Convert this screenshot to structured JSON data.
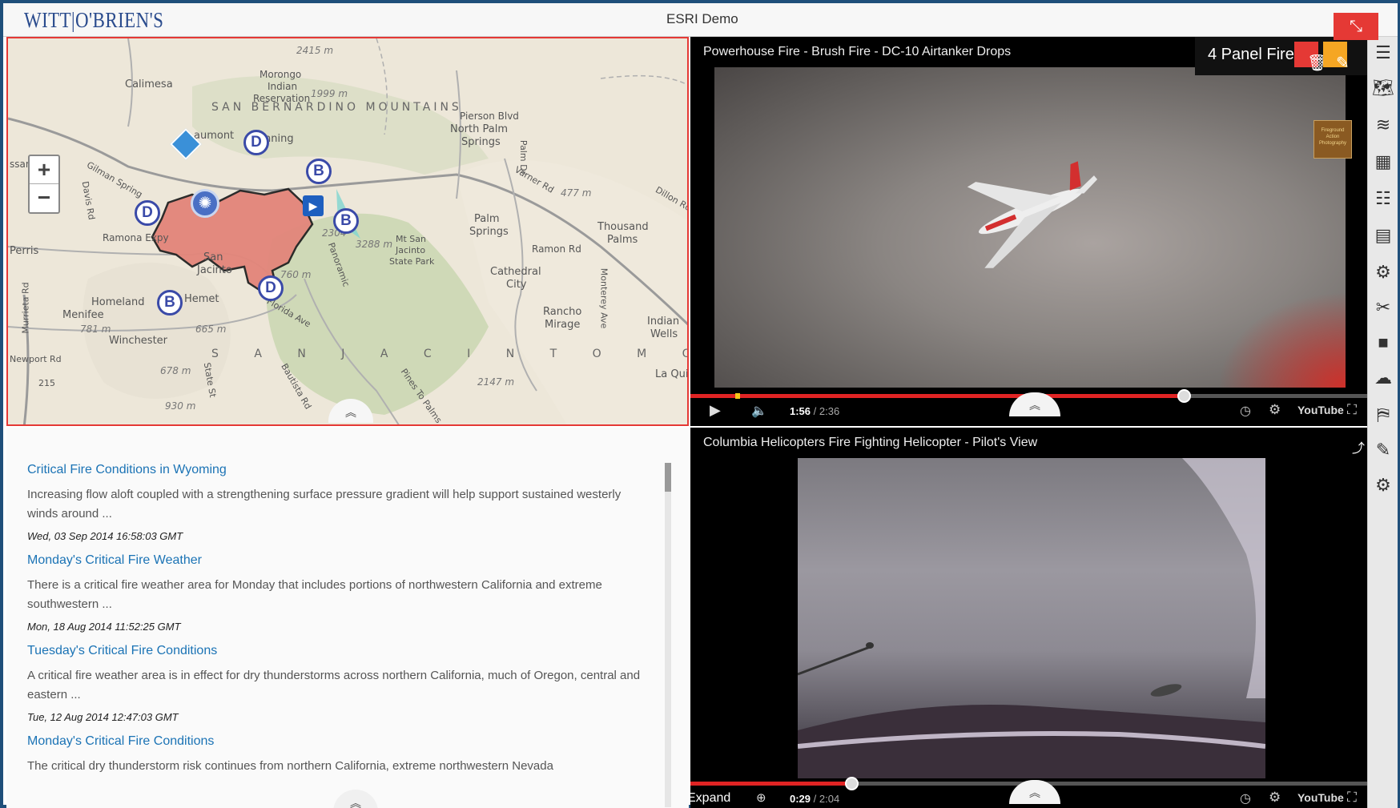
{
  "header": {
    "logo": "WITT|O'BRIEN'S",
    "title": "ESRI Demo",
    "collapse_icon": "compress-arrows-icon"
  },
  "map": {
    "zoom_in": "+",
    "zoom_out": "−",
    "labels": {
      "calimesa": "Calimesa",
      "morongo": "Morongo",
      "indian": "Indian",
      "reservation": "Reservation",
      "elev_2415": "2415 m",
      "elev_1999": "1999 m",
      "sbm": "SAN BERNARDINO MOUNTAINS",
      "pierson": "Pierson Blvd",
      "north_palm": "North Palm",
      "springs": "Springs",
      "beaumont": "aumont",
      "banning": "nning",
      "ramona": "Ramona Expy",
      "perris": "Perris",
      "san": "San",
      "jacinto": "Jacinto",
      "hemet": "Hemet",
      "homeland": "Homeland",
      "menifee": "Menifee",
      "winchester": "Winchester",
      "elev_781": "781 m",
      "elev_665": "665 m",
      "elev_678": "678 m",
      "elev_930": "930 m",
      "elev_760": "760 m",
      "elev_3288": "3288 m",
      "elev_2304": "2304",
      "mt_san": "Mt San",
      "jacinto2": "Jacinto",
      "state_park": "State Park",
      "sjm": "S A N   J A C I N T O   M O U N T A I N S",
      "elev_2147": "2147 m",
      "palm": "Palm",
      "springs2": "Springs",
      "cathedral": "Cathedral",
      "city": "City",
      "thousand": "Thousand",
      "palms": "Palms",
      "rancho": "Rancho",
      "mirage": "Mirage",
      "indian_wells1": "Indian",
      "wells": "Wells",
      "la_quinta": "La Qui",
      "elev_477": "477 m",
      "ramon_rd": "Ramon Rd",
      "varner": "Varner Rd",
      "dillon": "Dillon Rd",
      "newport": "Newport Rd",
      "ssan": "ssan",
      "palm_dr": "Palm Dr",
      "gilman": "Gilman Spring",
      "monterey": "Monterey Ave",
      "florida": "Florida Ave",
      "pines": "Pines To Palms",
      "bautista": "Bautista Rd",
      "murrieta": "Murrieta Rd",
      "davis": "Davis Rd",
      "state_st": "State St",
      "panoramic": "Panoramic",
      "s215": "215"
    },
    "markers": [
      "D",
      "B",
      "D",
      "B",
      "D",
      "B"
    ],
    "expand_icon": "chevron-up-icon"
  },
  "news": {
    "items": [
      {
        "title": "Critical Fire Conditions in Wyoming",
        "body": "Increasing flow aloft coupled with a strengthening surface pressure gradient will help support sustained westerly winds around ...",
        "date": "Wed, 03 Sep 2014 16:58:03 GMT"
      },
      {
        "title": "Monday's Critical Fire Weather",
        "body": "There is a critical fire weather area for Monday that includes portions of northwestern California and extreme southwestern ...",
        "date": "Mon, 18 Aug 2014 11:52:25 GMT"
      },
      {
        "title": "Tuesday's Critical Fire Conditions",
        "body": "A critical fire weather area is in effect for dry thunderstorms across northern California, much of Oregon, central and eastern ...",
        "date": "Tue, 12 Aug 2014 12:47:03 GMT"
      },
      {
        "title": "Monday's Critical Fire Conditions",
        "body": "The critical dry thunderstorm risk continues from northern California, extreme northwestern Nevada",
        "date": ""
      }
    ]
  },
  "video1": {
    "title": "Powerhouse Fire - Brush Fire - DC-10 Airtanker Drops",
    "panel_name": "4 Panel Fire",
    "watermark": "Fireground Action Photography",
    "current": "1:56",
    "duration": " / 2:36",
    "progress": 0.729,
    "youtube": "YouTube"
  },
  "video2": {
    "title": "Columbia Helicopters Fire Fighting Helicopter - Pilot's View",
    "current": "0:29",
    "duration": " / 2:04",
    "progress": 0.238,
    "expand_label": "Expand",
    "youtube": "YouTube"
  },
  "toolbar": {
    "icons": [
      "menu-icon",
      "world-map-icon",
      "layers-icon",
      "calculator-icon",
      "list-icon",
      "calendar-icon",
      "settings-icon",
      "tools-icon",
      "video-camera-icon",
      "weather-icon",
      "map-fold-icon",
      "edit-icon",
      "gears-icon"
    ]
  },
  "colors": {
    "accent_red": "#e53935",
    "link_blue": "#1b73b5",
    "brand_navy": "#2a4b8d",
    "fire_polygon": "#e3857a"
  }
}
